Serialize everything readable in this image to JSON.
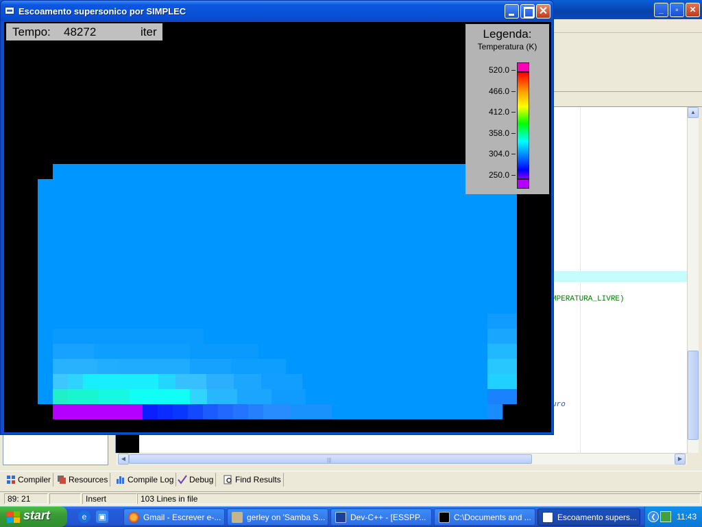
{
  "ide": {
    "code_line_1": "MPERATURA_LIVRE)",
    "code_line_2": "uro",
    "bottom_tabs": [
      {
        "label": "Compiler",
        "icon": "compiler-grid-icon"
      },
      {
        "label": "Resources",
        "icon": "resources-icon"
      },
      {
        "label": "Compile Log",
        "icon": "compile-log-chart-icon"
      },
      {
        "label": "Debug",
        "icon": "debug-check-icon"
      },
      {
        "label": "Find Results",
        "icon": "find-results-icon"
      }
    ],
    "status": {
      "position": "89: 21",
      "mode": "Insert",
      "lines": "103 Lines in file"
    }
  },
  "simplec": {
    "title": "Escoamento supersonico por SIMPLEC",
    "time_label": "Tempo:",
    "time_value": "48272",
    "time_unit": "iter",
    "legend": {
      "title": "Legenda:",
      "subtitle": "Temperatura (K)",
      "ticks": [
        "520.0",
        "466.0",
        "412.0",
        "358.0",
        "304.0",
        "250.0"
      ],
      "over_color": "#ff00b4",
      "under_color": "#b400ff"
    },
    "colors": {
      "background": "#000000",
      "field_base": "#0096ff",
      "inlet_wall": "#b400ff"
    }
  },
  "taskbar": {
    "start_label": "start",
    "tasks": [
      {
        "label": "Gmail - Escrever e-...",
        "icon": "firefox-icon"
      },
      {
        "label": "gerley on 'Samba S...",
        "icon": "network-drive-icon"
      },
      {
        "label": "Dev-C++ - [ESSPP...",
        "icon": "devcpp-icon"
      },
      {
        "label": "C:\\Documents and ...",
        "icon": "cmd-icon"
      },
      {
        "label": "Escoamento supers...",
        "icon": "app-window-icon"
      }
    ],
    "clock": "11:43"
  }
}
